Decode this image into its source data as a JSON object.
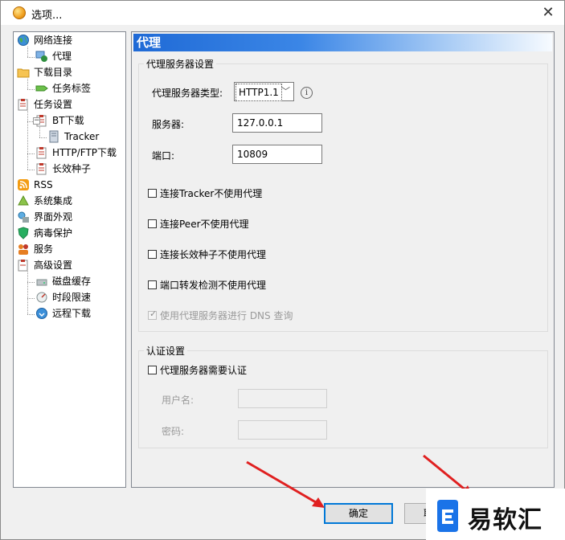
{
  "window": {
    "title": "选项...",
    "close_glyph": "✕"
  },
  "tree": [
    {
      "label": "网络连接",
      "icon": "globe-icon"
    },
    {
      "label": "代理",
      "icon": "proxy-icon",
      "selected": true
    },
    {
      "label": "下载目录",
      "icon": "folder-icon"
    },
    {
      "label": "任务标签",
      "icon": "tag-icon"
    },
    {
      "label": "任务设置",
      "icon": "task-icon"
    },
    {
      "label": "BT下载",
      "icon": "task-icon"
    },
    {
      "label": "Tracker",
      "icon": "server-icon"
    },
    {
      "label": "HTTP/FTP下载",
      "icon": "task-icon"
    },
    {
      "label": "长效种子",
      "icon": "task-icon"
    },
    {
      "label": "RSS",
      "icon": "rss-icon"
    },
    {
      "label": "系统集成",
      "icon": "integration-icon"
    },
    {
      "label": "界面外观",
      "icon": "appearance-icon"
    },
    {
      "label": "病毒保护",
      "icon": "shield-icon"
    },
    {
      "label": "服务",
      "icon": "users-icon"
    },
    {
      "label": "高级设置",
      "icon": "advanced-icon"
    },
    {
      "label": "磁盘缓存",
      "icon": "disk-icon"
    },
    {
      "label": "时段限速",
      "icon": "speed-icon"
    },
    {
      "label": "远程下载",
      "icon": "remote-icon"
    }
  ],
  "panel": {
    "title": "代理",
    "proxy_group": {
      "legend": "代理服务器设置",
      "type_label": "代理服务器类型:",
      "type_value": "HTTP1.1",
      "server_label": "服务器:",
      "server_value": "127.0.0.1",
      "port_label": "端口:",
      "port_value": "10809",
      "options": [
        {
          "label": "连接Tracker不使用代理",
          "checked": false,
          "disabled": false
        },
        {
          "label": "连接Peer不使用代理",
          "checked": false,
          "disabled": false
        },
        {
          "label": "连接长效种子不使用代理",
          "checked": false,
          "disabled": false
        },
        {
          "label": "端口转发检测不使用代理",
          "checked": false,
          "disabled": false
        },
        {
          "label": "使用代理服务器进行 DNS 查询",
          "checked": true,
          "disabled": true
        }
      ]
    },
    "auth_group": {
      "legend": "认证设置",
      "require_label": "代理服务器需要认证",
      "username_label": "用户名:",
      "username_value": "",
      "password_label": "密码:",
      "password_value": ""
    }
  },
  "buttons": {
    "ok": "确定",
    "cancel": "取"
  },
  "watermark": {
    "text": "易软汇"
  },
  "colors": {
    "header_start": "#1f6ad6",
    "default_button_border": "#0078d7",
    "arrow": "#e02020"
  }
}
